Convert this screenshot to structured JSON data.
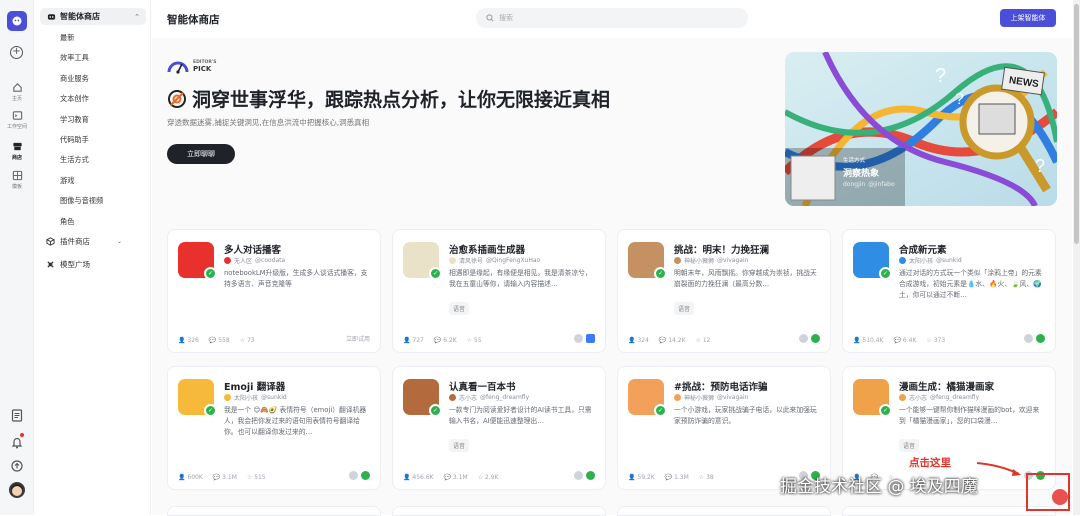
{
  "rail": {
    "items": [
      {
        "label": "主页"
      },
      {
        "label": "工作空间"
      },
      {
        "label": "商店"
      },
      {
        "label": "模板"
      }
    ]
  },
  "sidebar": {
    "top_label": "智能体商店",
    "sub_items": [
      "最新",
      "效率工具",
      "商业服务",
      "文本创作",
      "学习教育",
      "代码助手",
      "生活方式",
      "游戏",
      "图像与音视频",
      "角色"
    ],
    "plugin_store": "插件商店",
    "model_square": "模型广场"
  },
  "header": {
    "title": "智能体商店",
    "search_placeholder": "搜索",
    "publish_button": "上架智能体"
  },
  "hero": {
    "pick_line1": "EDITOR'S",
    "pick_line2": "PICK",
    "title": "洞穿世事浮华，跟踪热点分析，让你无限接近真相",
    "subtitle": "穿透数据迷雾,捕捉关键洞见,在信息洪流中把握核心,洞悉真相",
    "chat_button": "立即聊聊",
    "banner_tag": "生活方式",
    "banner_name": "洞察热象",
    "banner_author": "dongjin",
    "banner_handle": "@jinfabo"
  },
  "cards": [
    {
      "name": "多人对话播客",
      "author": "无人区",
      "handle": "@coodata",
      "desc": "notebookLM升级版，生成多人谈话式播客，支持多语言、声音克隆等",
      "tag": "",
      "stats": [
        "326",
        "558",
        "73"
      ],
      "right_text": "立即试用",
      "avatar_color": "#e8312d"
    },
    {
      "name": "治愈系插画生成器",
      "author": "清风徐号",
      "handle": "@QingFengXuHao",
      "desc": "相遇即是缘起，有缘便是相见。我是清茶凉兮，我在五童山等你，请输入内容描述…",
      "tag": "语音",
      "stats": [
        "727",
        "6.2K",
        "55"
      ],
      "right_text": "",
      "avatar_color": "#e9e2c8"
    },
    {
      "name": "挑战：明末！力挽狂澜",
      "author": "神秘小薇狮",
      "handle": "@vivagain",
      "desc": "明朝末年，风雨飘摇。你穿越成为崇祯，挑战天崩裂面的力挽狂澜（最高分数…",
      "tag": "语音",
      "stats": [
        "324",
        "14.2K",
        "12"
      ],
      "right_text": "",
      "avatar_color": "#c69162"
    },
    {
      "name": "合成新元素",
      "author": "太阳小孩",
      "handle": "@sunkid",
      "desc": "通过对话的方式玩一个类似「涂鸦上帝」的元素合成游戏，初始元素是💧水、🔥火、🍃风、🌍土，你可以通过不断…",
      "tag": "",
      "stats": [
        "510.4K",
        "6.4K",
        "373"
      ],
      "right_text": "",
      "avatar_color": "#2f8de4"
    },
    {
      "name": "Emoji 翻译器",
      "author": "太阳小孩",
      "handle": "@sunkid",
      "desc": "我是一个 😊🙈🥑 表情符号（emoji）翻译机器人，我会把你发过来的语句用表情符号翻译给你。也可以翻译你发过来的…",
      "tag": "",
      "stats": [
        "600K",
        "3.1M",
        "515"
      ],
      "right_text": "",
      "avatar_color": "#f7b93a"
    },
    {
      "name": "认真看一百本书",
      "author": "志小志",
      "handle": "@feng_dreamfly",
      "desc": "一款专门为阅读爱好者设计的AI读书工具，只需输入书名，AI便能迅速整理出…",
      "tag": "语音",
      "stats": [
        "456.6K",
        "3.1M",
        "2.9K"
      ],
      "right_text": "",
      "avatar_color": "#b36a3c"
    },
    {
      "name": "#挑战：预防电话诈骗",
      "author": "神秘小薇狮",
      "handle": "@vivagain",
      "desc": "一个小游戏，玩家挑战骗子电话，以此来加强玩家预防诈骗的意识。",
      "tag": "",
      "stats": [
        "59.2K",
        "1.3M",
        "38"
      ],
      "right_text": "",
      "avatar_color": "#f3a05a"
    },
    {
      "name": "漫画生成：橘猫漫画家",
      "author": "志小志",
      "handle": "@feng_dreamfly",
      "desc": "一个能够一键帮你制作猫咪漫画的bot，欢迎来到「橘猫漫画家」，您的口袋漫…",
      "tag": "语音",
      "stats": [
        "",
        "",
        ""
      ],
      "right_text": "",
      "avatar_color": "#f0a24a"
    }
  ],
  "overlay": {
    "annotation": "点击这里",
    "watermark": "掘金技术社区 @ 埃及四魔"
  }
}
